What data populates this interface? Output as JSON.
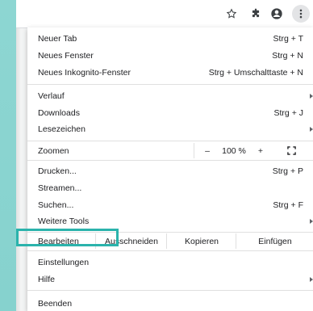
{
  "toolbar": {
    "icons": [
      "star-icon",
      "extension-icon",
      "profile-icon",
      "more-vert-icon"
    ]
  },
  "menu": {
    "items": [
      {
        "label": "Neuer Tab",
        "shortcut": "Strg + T"
      },
      {
        "label": "Neues Fenster",
        "shortcut": "Strg + N"
      },
      {
        "label": "Neues Inkognito-Fenster",
        "shortcut": "Strg + Umschalttaste + N"
      },
      {
        "label": "Verlauf",
        "shortcut": ""
      },
      {
        "label": "Downloads",
        "shortcut": "Strg + J"
      },
      {
        "label": "Lesezeichen",
        "shortcut": ""
      },
      {
        "label": "Drucken...",
        "shortcut": "Strg + P"
      },
      {
        "label": "Streamen...",
        "shortcut": ""
      },
      {
        "label": "Suchen...",
        "shortcut": "Strg + F"
      },
      {
        "label": "Weitere Tools",
        "shortcut": ""
      },
      {
        "label": "Einstellungen",
        "shortcut": ""
      },
      {
        "label": "Hilfe",
        "shortcut": ""
      },
      {
        "label": "Beenden",
        "shortcut": ""
      }
    ],
    "zoom": {
      "label": "Zoomen",
      "minus": "–",
      "value": "100 %",
      "plus": "+"
    },
    "edit": {
      "label": "Bearbeiten",
      "cut": "Ausschneiden",
      "copy": "Kopieren",
      "paste": "Einfügen"
    }
  },
  "colors": {
    "highlight": "#2bb3ac",
    "side_panel": "#8dd6d2"
  }
}
